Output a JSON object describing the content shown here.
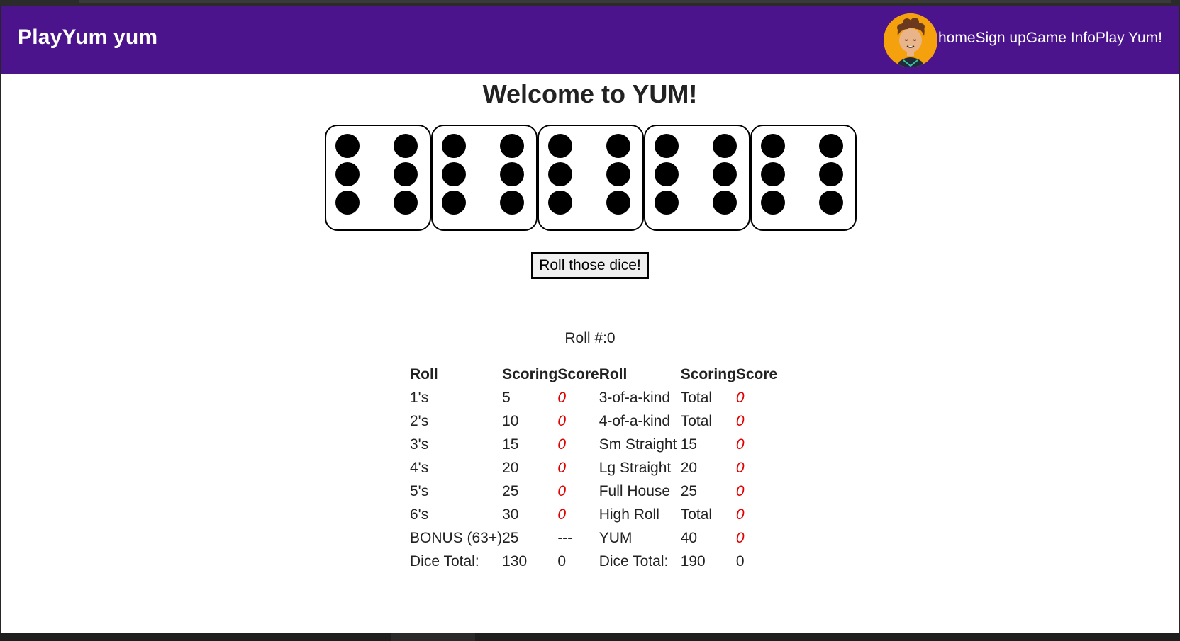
{
  "app": {
    "brand": "PlayYum yum",
    "colors": {
      "appbar": "#4b148c",
      "avatar_bg": "#f5a00d",
      "score_zero": "#e00000"
    }
  },
  "nav": {
    "avatar_icon": "cartoon-face-avatar",
    "items": [
      "home",
      "Sign up",
      "Game Info",
      "Play Yum!"
    ]
  },
  "main": {
    "welcome": "Welcome to YUM!",
    "dice": [
      6,
      6,
      6,
      6,
      6
    ],
    "roll_button": "Roll those dice!",
    "roll_count": "Roll #:0"
  },
  "scorecard": {
    "headers": [
      "Roll",
      "Scoring",
      "Score",
      "Roll",
      "Scoring",
      "Score"
    ],
    "rows": [
      [
        "1's",
        "5",
        "0",
        "3-of-a-kind",
        "Total",
        "0"
      ],
      [
        "2's",
        "10",
        "0",
        "4-of-a-kind",
        "Total",
        "0"
      ],
      [
        "3's",
        "15",
        "0",
        "Sm Straight",
        "15",
        "0"
      ],
      [
        "4's",
        "20",
        "0",
        "Lg Straight",
        "20",
        "0"
      ],
      [
        "5's",
        "25",
        "0",
        "Full House",
        "25",
        "0"
      ],
      [
        "6's",
        "30",
        "0",
        "High Roll",
        "Total",
        "0"
      ],
      [
        "BONUS (63+)",
        "25",
        "---",
        "YUM",
        "40",
        "0"
      ],
      [
        "Dice Total:",
        "130",
        "0",
        "Dice Total:",
        "190",
        "0"
      ]
    ]
  }
}
